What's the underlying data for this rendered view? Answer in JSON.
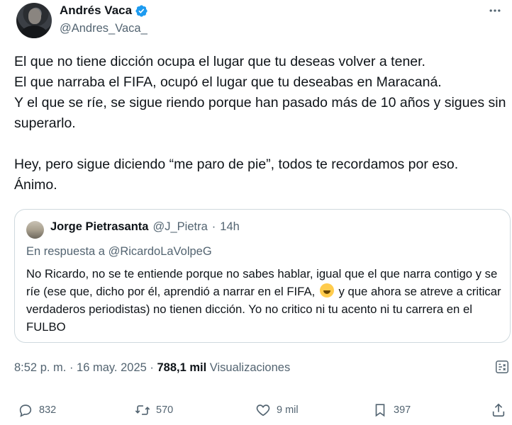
{
  "author": {
    "display_name": "Andrés Vaca",
    "handle": "@Andres_Vaca_",
    "verified": true
  },
  "tweet": {
    "text": "El que no tiene dicción ocupa el lugar que tu deseas volver a tener.\nEl que narraba el FIFA, ocupó el lugar que tu deseabas en Maracaná.\nY el que se ríe, se sigue riendo porque han pasado más de 10 años y sigues sin superarlo.\n\nHey, pero sigue diciendo “me paro de pie”, todos te recordamos por eso.\nÁnimo."
  },
  "quote": {
    "display_name": "Jorge Pietrasanta",
    "handle": "@J_Pietra",
    "separator": "·",
    "time": "14h",
    "reply_prefix": "En respuesta a",
    "reply_to": "@RicardoLaVolpeG",
    "text_before_emoji": "No Ricardo, no se te entiende porque no sabes hablar, igual que el que narra contigo y se ríe (ese que, dicho por él, aprendió a narrar en el FIFA, ",
    "emoji": "rolling-on-floor-laughing",
    "text_after_emoji": " y que ahora se atreve a criticar verdaderos periodistas)  no tienen dicción. Yo no critico ni tu acento ni tu carrera en el FULBO"
  },
  "meta": {
    "time_date": "8:52 p. m. · 16 may. 2025 · ",
    "views_count": "788,1 mil",
    "views_label": " Visualizaciones"
  },
  "actions": {
    "replies": "832",
    "reposts": "570",
    "likes": "9 mil",
    "bookmarks": "397"
  },
  "colors": {
    "text_primary": "#0f1419",
    "text_secondary": "#536471",
    "verified_blue": "#1d9bf0",
    "border": "#cfd9de"
  }
}
